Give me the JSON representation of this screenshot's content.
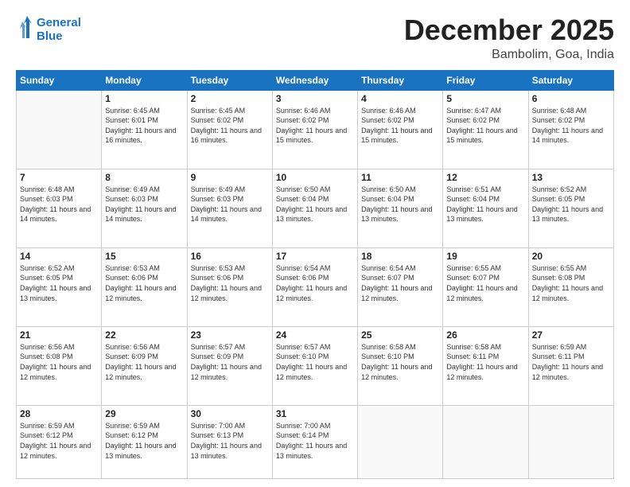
{
  "header": {
    "logo_line1": "General",
    "logo_line2": "Blue",
    "month": "December 2025",
    "location": "Bambolim, Goa, India"
  },
  "days_of_week": [
    "Sunday",
    "Monday",
    "Tuesday",
    "Wednesday",
    "Thursday",
    "Friday",
    "Saturday"
  ],
  "weeks": [
    [
      {
        "day": "",
        "sunrise": "",
        "sunset": "",
        "daylight": ""
      },
      {
        "day": "1",
        "sunrise": "Sunrise: 6:45 AM",
        "sunset": "Sunset: 6:01 PM",
        "daylight": "Daylight: 11 hours and 16 minutes."
      },
      {
        "day": "2",
        "sunrise": "Sunrise: 6:45 AM",
        "sunset": "Sunset: 6:02 PM",
        "daylight": "Daylight: 11 hours and 16 minutes."
      },
      {
        "day": "3",
        "sunrise": "Sunrise: 6:46 AM",
        "sunset": "Sunset: 6:02 PM",
        "daylight": "Daylight: 11 hours and 15 minutes."
      },
      {
        "day": "4",
        "sunrise": "Sunrise: 6:46 AM",
        "sunset": "Sunset: 6:02 PM",
        "daylight": "Daylight: 11 hours and 15 minutes."
      },
      {
        "day": "5",
        "sunrise": "Sunrise: 6:47 AM",
        "sunset": "Sunset: 6:02 PM",
        "daylight": "Daylight: 11 hours and 15 minutes."
      },
      {
        "day": "6",
        "sunrise": "Sunrise: 6:48 AM",
        "sunset": "Sunset: 6:02 PM",
        "daylight": "Daylight: 11 hours and 14 minutes."
      }
    ],
    [
      {
        "day": "7",
        "sunrise": "Sunrise: 6:48 AM",
        "sunset": "Sunset: 6:03 PM",
        "daylight": "Daylight: 11 hours and 14 minutes."
      },
      {
        "day": "8",
        "sunrise": "Sunrise: 6:49 AM",
        "sunset": "Sunset: 6:03 PM",
        "daylight": "Daylight: 11 hours and 14 minutes."
      },
      {
        "day": "9",
        "sunrise": "Sunrise: 6:49 AM",
        "sunset": "Sunset: 6:03 PM",
        "daylight": "Daylight: 11 hours and 14 minutes."
      },
      {
        "day": "10",
        "sunrise": "Sunrise: 6:50 AM",
        "sunset": "Sunset: 6:04 PM",
        "daylight": "Daylight: 11 hours and 13 minutes."
      },
      {
        "day": "11",
        "sunrise": "Sunrise: 6:50 AM",
        "sunset": "Sunset: 6:04 PM",
        "daylight": "Daylight: 11 hours and 13 minutes."
      },
      {
        "day": "12",
        "sunrise": "Sunrise: 6:51 AM",
        "sunset": "Sunset: 6:04 PM",
        "daylight": "Daylight: 11 hours and 13 minutes."
      },
      {
        "day": "13",
        "sunrise": "Sunrise: 6:52 AM",
        "sunset": "Sunset: 6:05 PM",
        "daylight": "Daylight: 11 hours and 13 minutes."
      }
    ],
    [
      {
        "day": "14",
        "sunrise": "Sunrise: 6:52 AM",
        "sunset": "Sunset: 6:05 PM",
        "daylight": "Daylight: 11 hours and 13 minutes."
      },
      {
        "day": "15",
        "sunrise": "Sunrise: 6:53 AM",
        "sunset": "Sunset: 6:06 PM",
        "daylight": "Daylight: 11 hours and 12 minutes."
      },
      {
        "day": "16",
        "sunrise": "Sunrise: 6:53 AM",
        "sunset": "Sunset: 6:06 PM",
        "daylight": "Daylight: 11 hours and 12 minutes."
      },
      {
        "day": "17",
        "sunrise": "Sunrise: 6:54 AM",
        "sunset": "Sunset: 6:06 PM",
        "daylight": "Daylight: 11 hours and 12 minutes."
      },
      {
        "day": "18",
        "sunrise": "Sunrise: 6:54 AM",
        "sunset": "Sunset: 6:07 PM",
        "daylight": "Daylight: 11 hours and 12 minutes."
      },
      {
        "day": "19",
        "sunrise": "Sunrise: 6:55 AM",
        "sunset": "Sunset: 6:07 PM",
        "daylight": "Daylight: 11 hours and 12 minutes."
      },
      {
        "day": "20",
        "sunrise": "Sunrise: 6:55 AM",
        "sunset": "Sunset: 6:08 PM",
        "daylight": "Daylight: 11 hours and 12 minutes."
      }
    ],
    [
      {
        "day": "21",
        "sunrise": "Sunrise: 6:56 AM",
        "sunset": "Sunset: 6:08 PM",
        "daylight": "Daylight: 11 hours and 12 minutes."
      },
      {
        "day": "22",
        "sunrise": "Sunrise: 6:56 AM",
        "sunset": "Sunset: 6:09 PM",
        "daylight": "Daylight: 11 hours and 12 minutes."
      },
      {
        "day": "23",
        "sunrise": "Sunrise: 6:57 AM",
        "sunset": "Sunset: 6:09 PM",
        "daylight": "Daylight: 11 hours and 12 minutes."
      },
      {
        "day": "24",
        "sunrise": "Sunrise: 6:57 AM",
        "sunset": "Sunset: 6:10 PM",
        "daylight": "Daylight: 11 hours and 12 minutes."
      },
      {
        "day": "25",
        "sunrise": "Sunrise: 6:58 AM",
        "sunset": "Sunset: 6:10 PM",
        "daylight": "Daylight: 11 hours and 12 minutes."
      },
      {
        "day": "26",
        "sunrise": "Sunrise: 6:58 AM",
        "sunset": "Sunset: 6:11 PM",
        "daylight": "Daylight: 11 hours and 12 minutes."
      },
      {
        "day": "27",
        "sunrise": "Sunrise: 6:59 AM",
        "sunset": "Sunset: 6:11 PM",
        "daylight": "Daylight: 11 hours and 12 minutes."
      }
    ],
    [
      {
        "day": "28",
        "sunrise": "Sunrise: 6:59 AM",
        "sunset": "Sunset: 6:12 PM",
        "daylight": "Daylight: 11 hours and 12 minutes."
      },
      {
        "day": "29",
        "sunrise": "Sunrise: 6:59 AM",
        "sunset": "Sunset: 6:12 PM",
        "daylight": "Daylight: 11 hours and 13 minutes."
      },
      {
        "day": "30",
        "sunrise": "Sunrise: 7:00 AM",
        "sunset": "Sunset: 6:13 PM",
        "daylight": "Daylight: 11 hours and 13 minutes."
      },
      {
        "day": "31",
        "sunrise": "Sunrise: 7:00 AM",
        "sunset": "Sunset: 6:14 PM",
        "daylight": "Daylight: 11 hours and 13 minutes."
      },
      {
        "day": "",
        "sunrise": "",
        "sunset": "",
        "daylight": ""
      },
      {
        "day": "",
        "sunrise": "",
        "sunset": "",
        "daylight": ""
      },
      {
        "day": "",
        "sunrise": "",
        "sunset": "",
        "daylight": ""
      }
    ]
  ]
}
